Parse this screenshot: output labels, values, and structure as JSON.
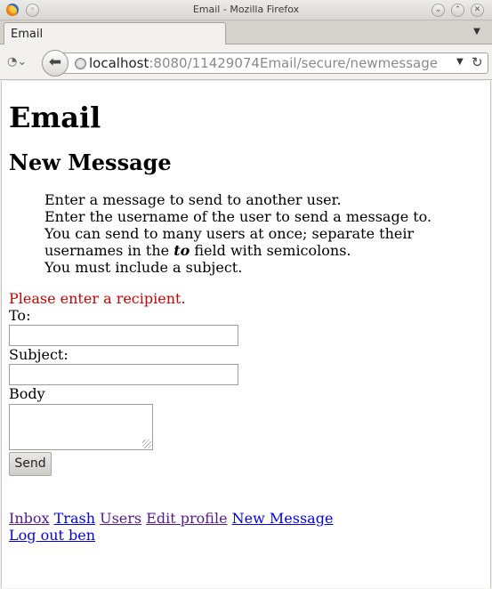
{
  "window": {
    "title": "Email - Mozilla Firefox"
  },
  "tab": {
    "label": "Email"
  },
  "urlbar": {
    "host": "localhost",
    "path": ":8080/11429074Email/secure/newmessage"
  },
  "page": {
    "title": "Email",
    "subtitle": "New Message",
    "instructions": {
      "line1": "Enter a message to send to another user.",
      "line2": "Enter the username of the user to send a message to.",
      "line3_pre": "You can send to many users at once; separate their usernames in the ",
      "line3_em": "to",
      "line3_post": " field with semicolons.",
      "line4": "You must include a subject."
    },
    "error": "Please enter a recipient.",
    "form": {
      "to_label": "To:",
      "to_value": "",
      "subject_label": "Subject:",
      "subject_value": "",
      "body_label": "Body",
      "body_value": "",
      "send_label": "Send"
    },
    "footer": {
      "inbox": "Inbox",
      "trash": "Trash",
      "users": "Users",
      "edit_profile": "Edit profile",
      "new_message": "New Message",
      "logout": "Log out ben"
    }
  },
  "colors": {
    "error": "#cc0000",
    "link_unvisited": "#0000ee",
    "link_visited": "#551a8b"
  }
}
